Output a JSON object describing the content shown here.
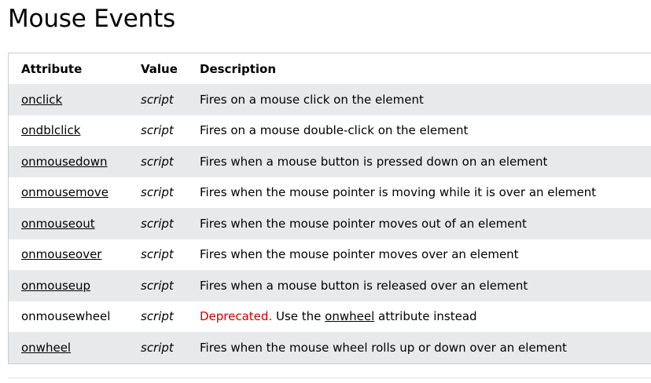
{
  "page": {
    "title": "Mouse Events"
  },
  "table": {
    "headers": {
      "attribute": "Attribute",
      "value": "Value",
      "description": "Description"
    },
    "rows": [
      {
        "attribute": "onclick",
        "value": "script",
        "description": "Fires on a mouse click on the element"
      },
      {
        "attribute": "ondblclick",
        "value": "script",
        "description": "Fires on a mouse double-click on the element"
      },
      {
        "attribute": "onmousedown",
        "value": "script",
        "description": "Fires when a mouse button is pressed down on an element"
      },
      {
        "attribute": "onmousemove",
        "value": "script",
        "description": "Fires when the mouse pointer is moving while it is over an element"
      },
      {
        "attribute": "onmouseout",
        "value": "script",
        "description": "Fires when the mouse pointer moves out of an element"
      },
      {
        "attribute": "onmouseover",
        "value": "script",
        "description": "Fires when the mouse pointer moves over an element"
      },
      {
        "attribute": "onmouseup",
        "value": "script",
        "description": "Fires when a mouse button is released over an element"
      },
      {
        "attribute": "onmousewheel",
        "value": "script",
        "description_parts": {
          "deprecated": "Deprecated.",
          "before_link": " Use the ",
          "link": "onwheel",
          "after_link": " attribute instead"
        }
      },
      {
        "attribute": "onwheel",
        "value": "script",
        "description": "Fires when the mouse wheel rolls up or down over an element"
      }
    ]
  },
  "colors": {
    "row_stripe": "#e7e9eb",
    "deprecated": "#cc0000",
    "border": "#cccccc"
  }
}
